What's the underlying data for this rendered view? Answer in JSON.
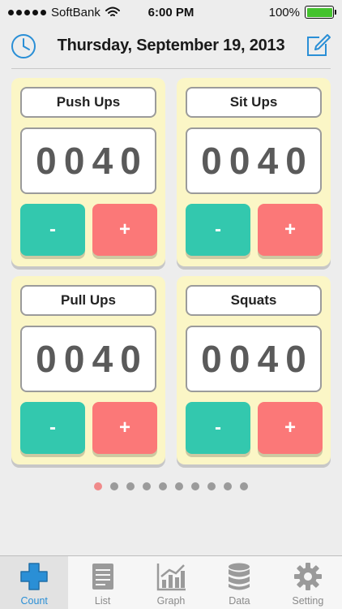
{
  "status_bar": {
    "carrier": "SoftBank",
    "time": "6:00 PM",
    "battery": "100%",
    "battery_color": "#44c32e",
    "icons": [
      "signal-dots-icon",
      "wifi-icon",
      "battery-icon"
    ]
  },
  "header": {
    "title": "Thursday, September 19, 2013",
    "left_icon": "clock-icon",
    "right_icon": "edit-icon",
    "accent": "#2a8fd6"
  },
  "counters": [
    {
      "label": "Push Ups",
      "digits": [
        "0",
        "0",
        "4",
        "0"
      ],
      "minus_label": "-",
      "plus_label": "+"
    },
    {
      "label": "Sit Ups",
      "digits": [
        "0",
        "0",
        "4",
        "0"
      ],
      "minus_label": "-",
      "plus_label": "+"
    },
    {
      "label": "Pull Ups",
      "digits": [
        "0",
        "0",
        "4",
        "0"
      ],
      "minus_label": "-",
      "plus_label": "+"
    },
    {
      "label": "Squats",
      "digits": [
        "0",
        "0",
        "4",
        "0"
      ],
      "minus_label": "-",
      "plus_label": "+"
    }
  ],
  "colors": {
    "card_bg": "#fbf6c6",
    "minus_button": "#33c8ae",
    "plus_button": "#fb7878",
    "active_dot": "#f08a8a"
  },
  "pagination": {
    "total_pages": 10,
    "current_page": 1
  },
  "tab_bar": {
    "active_tab": "Count",
    "tabs": [
      {
        "label": "Count",
        "icon": "count-plus-icon"
      },
      {
        "label": "List",
        "icon": "list-icon"
      },
      {
        "label": "Graph",
        "icon": "graph-icon"
      },
      {
        "label": "Data",
        "icon": "data-icon"
      },
      {
        "label": "Setting",
        "icon": "gear-icon"
      }
    ]
  }
}
